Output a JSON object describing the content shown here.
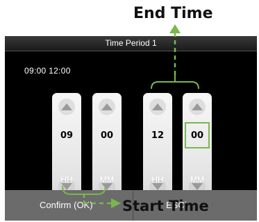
{
  "annotations": {
    "end_time": "End Time",
    "start_time": "Start Time"
  },
  "screen": {
    "title": "Time Period 1",
    "period_summary": "09:00  12:00",
    "spinners": [
      {
        "value": "09",
        "unit": "HH",
        "selected": false
      },
      {
        "value": "00",
        "unit": "MM",
        "selected": false
      },
      {
        "value": "12",
        "unit": "HH",
        "selected": false
      },
      {
        "value": "00",
        "unit": "MM",
        "selected": true
      }
    ],
    "confirm_label": "Confirm (OK)",
    "esc_label": "ESC)"
  },
  "colors": {
    "annotation_green": "#79b84a",
    "screen_bg": "#000000",
    "bar_bg": "#6b6b6b"
  }
}
